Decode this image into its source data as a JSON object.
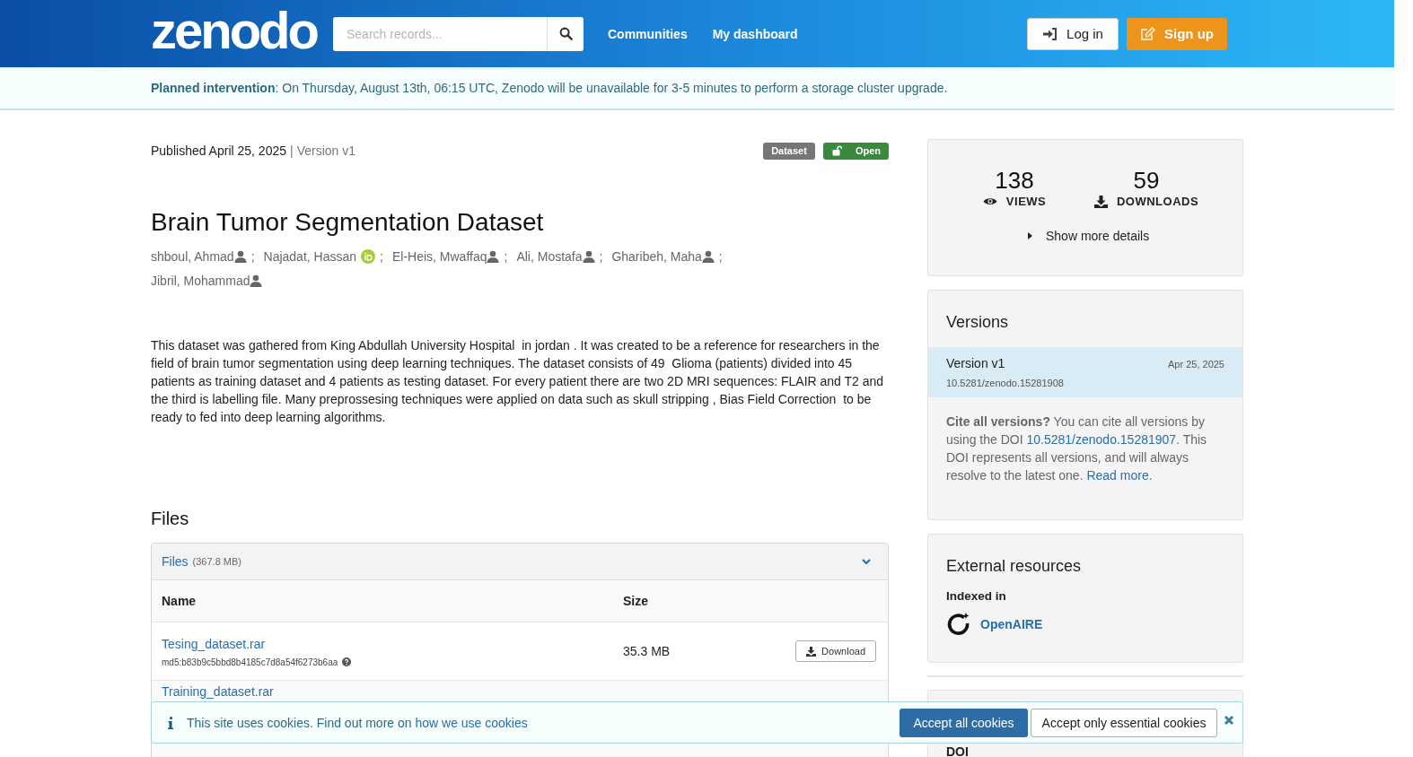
{
  "header": {
    "logo": "zenodo",
    "search": {
      "placeholder": "Search records..."
    },
    "nav": [
      "Communities",
      "My dashboard"
    ],
    "login": "Log in",
    "signup": "Sign up"
  },
  "notice": "**Planned intervention**: On Thursday, August 13th, 06:15 UTC, Zenodo will be unavailable for 3-5 minutes to perform a storage cluster upgrade.",
  "record": {
    "published": "Published April 25, 2025",
    "separator": "|",
    "version": "Version v1",
    "badges": [
      {
        "label": "Dataset",
        "kind": "type"
      },
      {
        "label": "Open",
        "kind": "access"
      }
    ],
    "title": "Brain Tumor Segmentation Dataset",
    "authors": [
      {
        "name": "shboul, Ahmad",
        "kind": "person",
        "sep": ";"
      },
      {
        "name": "Najadat, Hassan",
        "kind": "orcid",
        "sep": ";"
      },
      {
        "name": "El-Heis, Mwaffaq",
        "kind": "person",
        "sep": ";"
      },
      {
        "name": "Ali, Mostafa",
        "kind": "person",
        "sep": ";"
      },
      {
        "name": "Gharibeh, Maha",
        "kind": "person",
        "sep": ";"
      },
      {
        "name": "Jibril, Mohammad",
        "kind": "person"
      }
    ],
    "description": "This dataset was gathered from King Abdullah University Hospital  in jordan . It was created to be a reference for researchers in the field of brain tumor segmentation using deep learning techniques. The dataset consists of 49  Glioma (patients) divided into 45 patients as training dataset and 4 patients as testing dataset. For every patient there are two 2D MRI sequences: FLAIR and T2 and the third is labelling file. Many preprossesing techniques were applied on data such as skull stripping , Bias Field Correction  to be ready to fed into deep learning algorithms."
  },
  "files": {
    "heading": "Files",
    "panel_title": "Files",
    "total": "(367.8 MB)",
    "expanded": true,
    "columns": [
      "Name",
      "Size"
    ],
    "rows": [
      {
        "name": "Tesing_dataset.rar",
        "checksum": "md5:b83b9c5bbd8b4185c7d8a54f6273b6aa",
        "size": "35.3 MB",
        "action": "Download"
      },
      {
        "name": "Training_dataset.rar"
      }
    ]
  },
  "stats": {
    "views": "138",
    "views_label": "VIEWS",
    "downloads": "59",
    "downloads_label": "DOWNLOADS",
    "details": "Show more details",
    "expanded": false
  },
  "versions": {
    "heading": "Versions",
    "items": [
      {
        "label": "Version v1",
        "date": "Apr 25, 2025",
        "doi": "10.5281/zenodo.15281908",
        "selected": true
      }
    ],
    "cite": {
      "before": "**Cite all versions?** You can cite all versions by using the DOI ",
      "doi_link": "10.5281/zenodo.15281907",
      "middle": ". This DOI represents all versions, and will always resolve to the latest one. ",
      "read_more": "Read more",
      "end": "."
    }
  },
  "external": {
    "heading": "External resources",
    "subheading": "Indexed in",
    "link": "OpenAIRE"
  },
  "next_card": {
    "heading": "DOI"
  },
  "cookies": {
    "text": "This site uses cookies. Find out more on ",
    "link": "how we use cookies",
    "accept_all": "Accept all cookies",
    "accept_essential": "Accept only essential cookies"
  }
}
